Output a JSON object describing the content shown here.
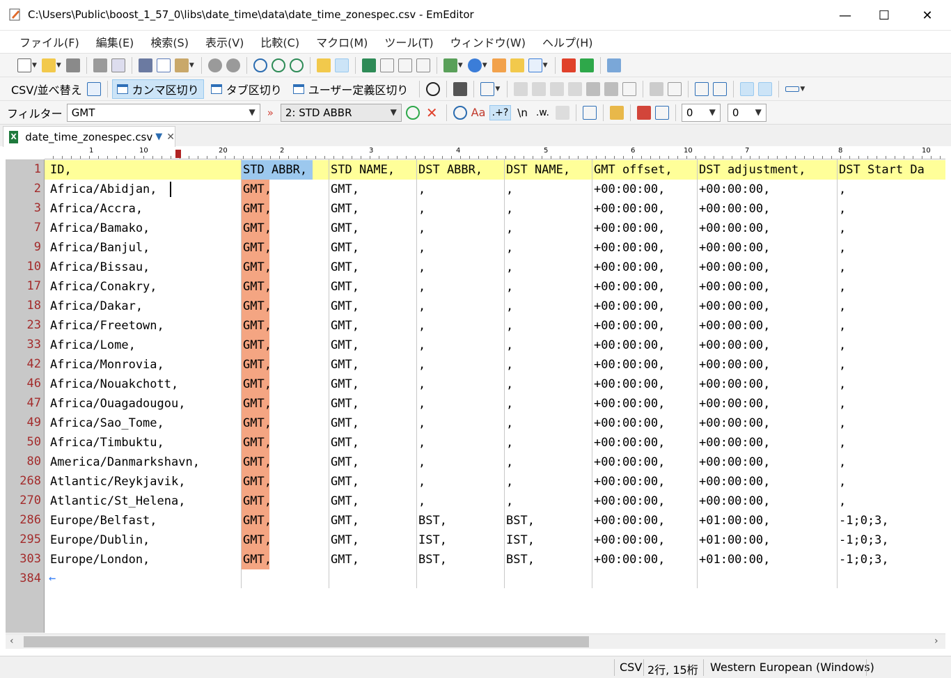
{
  "window": {
    "title": "C:\\Users\\Public\\boost_1_57_0\\libs\\date_time\\data\\date_time_zonespec.csv - EmEditor",
    "minimize": "—",
    "maximize": "☐",
    "close": "✕"
  },
  "menu": [
    "ファイル(F)",
    "編集(E)",
    "検索(S)",
    "表示(V)",
    "比較(C)",
    "マクロ(M)",
    "ツール(T)",
    "ウィンドウ(W)",
    "ヘルプ(H)"
  ],
  "csv_toolbar": {
    "sort_label": "CSV/並べ替え",
    "comma": "カンマ区切り",
    "tab": "タブ区切り",
    "user": "ユーザー定義区切り"
  },
  "filter_bar": {
    "label": "フィルター",
    "value": "GMT",
    "raquo": "»",
    "column": "2: STD ABBR",
    "newline_token": "\\n",
    "word_token": ".w.",
    "regex_token": ".+?",
    "num1": "0",
    "num2": "0"
  },
  "tab": {
    "name": "date_time_zonespec.csv"
  },
  "ruler_labels": [
    "1",
    "10",
    "20",
    "2",
    "3",
    "4",
    "5",
    "6",
    "7",
    "8",
    "10",
    "10"
  ],
  "columns": [
    "ID,",
    "STD ABBR,",
    "STD NAME,",
    "DST ABBR,",
    "DST NAME,",
    "GMT offset,",
    "DST adjustment,",
    "DST Start Da"
  ],
  "rows": [
    {
      "line": "2",
      "c": [
        "Africa/Abidjan,",
        "GMT,",
        "GMT,",
        ",",
        ",",
        "+00:00:00,",
        "+00:00:00,",
        ","
      ]
    },
    {
      "line": "3",
      "c": [
        "Africa/Accra,",
        "GMT,",
        "GMT,",
        ",",
        ",",
        "+00:00:00,",
        "+00:00:00,",
        ","
      ]
    },
    {
      "line": "7",
      "c": [
        "Africa/Bamako,",
        "GMT,",
        "GMT,",
        ",",
        ",",
        "+00:00:00,",
        "+00:00:00,",
        ","
      ]
    },
    {
      "line": "9",
      "c": [
        "Africa/Banjul,",
        "GMT,",
        "GMT,",
        ",",
        ",",
        "+00:00:00,",
        "+00:00:00,",
        ","
      ]
    },
    {
      "line": "10",
      "c": [
        "Africa/Bissau,",
        "GMT,",
        "GMT,",
        ",",
        ",",
        "+00:00:00,",
        "+00:00:00,",
        ","
      ]
    },
    {
      "line": "17",
      "c": [
        "Africa/Conakry,",
        "GMT,",
        "GMT,",
        ",",
        ",",
        "+00:00:00,",
        "+00:00:00,",
        ","
      ]
    },
    {
      "line": "18",
      "c": [
        "Africa/Dakar,",
        "GMT,",
        "GMT,",
        ",",
        ",",
        "+00:00:00,",
        "+00:00:00,",
        ","
      ]
    },
    {
      "line": "23",
      "c": [
        "Africa/Freetown,",
        "GMT,",
        "GMT,",
        ",",
        ",",
        "+00:00:00,",
        "+00:00:00,",
        ","
      ]
    },
    {
      "line": "33",
      "c": [
        "Africa/Lome,",
        "GMT,",
        "GMT,",
        ",",
        ",",
        "+00:00:00,",
        "+00:00:00,",
        ","
      ]
    },
    {
      "line": "42",
      "c": [
        "Africa/Monrovia,",
        "GMT,",
        "GMT,",
        ",",
        ",",
        "+00:00:00,",
        "+00:00:00,",
        ","
      ]
    },
    {
      "line": "46",
      "c": [
        "Africa/Nouakchott,",
        "GMT,",
        "GMT,",
        ",",
        ",",
        "+00:00:00,",
        "+00:00:00,",
        ","
      ]
    },
    {
      "line": "47",
      "c": [
        "Africa/Ouagadougou,",
        "GMT,",
        "GMT,",
        ",",
        ",",
        "+00:00:00,",
        "+00:00:00,",
        ","
      ]
    },
    {
      "line": "49",
      "c": [
        "Africa/Sao_Tome,",
        "GMT,",
        "GMT,",
        ",",
        ",",
        "+00:00:00,",
        "+00:00:00,",
        ","
      ]
    },
    {
      "line": "50",
      "c": [
        "Africa/Timbuktu,",
        "GMT,",
        "GMT,",
        ",",
        ",",
        "+00:00:00,",
        "+00:00:00,",
        ","
      ]
    },
    {
      "line": "80",
      "c": [
        "America/Danmarkshavn,",
        "GMT,",
        "GMT,",
        ",",
        ",",
        "+00:00:00,",
        "+00:00:00,",
        ","
      ]
    },
    {
      "line": "268",
      "c": [
        "Atlantic/Reykjavik,",
        "GMT,",
        "GMT,",
        ",",
        ",",
        "+00:00:00,",
        "+00:00:00,",
        ","
      ]
    },
    {
      "line": "270",
      "c": [
        "Atlantic/St_Helena,",
        "GMT,",
        "GMT,",
        ",",
        ",",
        "+00:00:00,",
        "+00:00:00,",
        ","
      ]
    },
    {
      "line": "286",
      "c": [
        "Europe/Belfast,",
        "GMT,",
        "GMT,",
        "BST,",
        "BST,",
        "+00:00:00,",
        "+01:00:00,",
        "-1;0;3,"
      ]
    },
    {
      "line": "295",
      "c": [
        "Europe/Dublin,",
        "GMT,",
        "GMT,",
        "IST,",
        "IST,",
        "+00:00:00,",
        "+01:00:00,",
        "-1;0;3,"
      ]
    },
    {
      "line": "303",
      "c": [
        "Europe/London,",
        "GMT,",
        "GMT,",
        "BST,",
        "BST,",
        "+00:00:00,",
        "+01:00:00,",
        "-1;0;3,"
      ]
    }
  ],
  "header_line": "1",
  "eof_line": "384",
  "eof_glyph": "←",
  "status": {
    "mode": "CSV",
    "position": "2行, 15桁",
    "encoding": "Western European (Windows)"
  },
  "colors": {
    "header_bg": "#ffff99",
    "selected_header": "#9cc8ee",
    "filter_highlight": "#f4a582",
    "line_number": "#a32b2b"
  }
}
